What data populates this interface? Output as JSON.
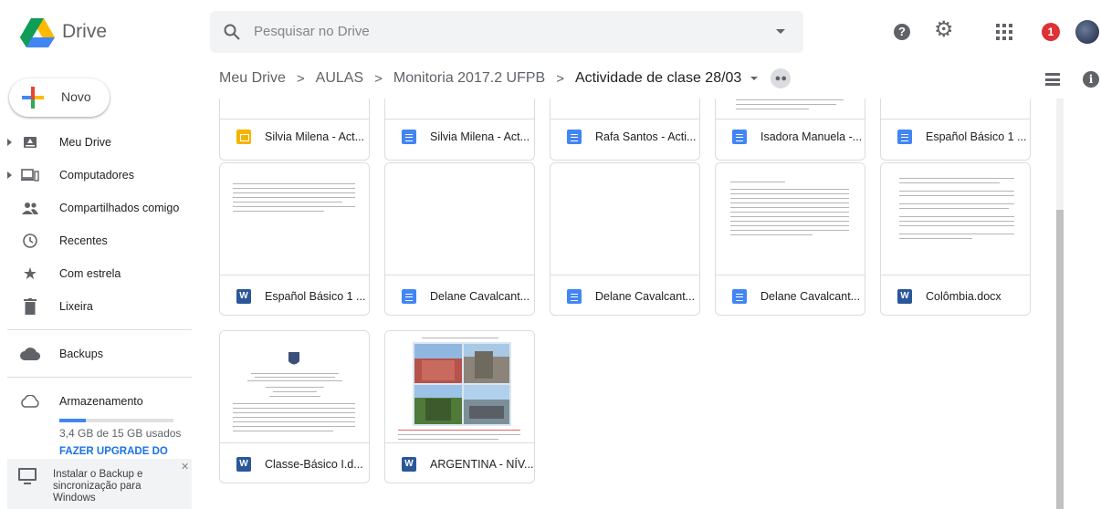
{
  "header": {
    "brand": "Drive",
    "search_placeholder": "Pesquisar no Drive",
    "notification_count": "1"
  },
  "breadcrumb": {
    "items": [
      "Meu Drive",
      "AULAS",
      "Monitoria 2017.2 UFPB"
    ],
    "current": "Actividade de clase 28/03"
  },
  "sidebar": {
    "new_label": "Novo",
    "items": [
      {
        "label": "Meu Drive",
        "icon": "drive-icon"
      },
      {
        "label": "Computadores",
        "icon": "computer-icon"
      },
      {
        "label": "Compartilhados comigo",
        "icon": "shared-icon"
      },
      {
        "label": "Recentes",
        "icon": "clock-icon"
      },
      {
        "label": "Com estrela",
        "icon": "star-icon"
      },
      {
        "label": "Lixeira",
        "icon": "trash-icon"
      },
      {
        "label": "Backups",
        "icon": "cloud-icon"
      },
      {
        "label": "Armazenamento",
        "icon": "cloud-outline-icon"
      }
    ],
    "storage_text": "3,4 GB de 15 GB usados",
    "storage_fraction": 0.23,
    "upgrade_label": "FAZER UPGRADE DO",
    "backup_prompt": "Instalar o Backup e sincronização para Windows"
  },
  "files": [
    {
      "name": "Silvia Milena - Act...",
      "type": "slide"
    },
    {
      "name": "Silvia Milena - Act...",
      "type": "doc"
    },
    {
      "name": "Rafa Santos - Acti...",
      "type": "doc"
    },
    {
      "name": "Isadora Manuela -...",
      "type": "doc"
    },
    {
      "name": "Español Básico 1 ...",
      "type": "doc"
    },
    {
      "name": "Español Básico 1 ...",
      "type": "word"
    },
    {
      "name": "Delane Cavalcant...",
      "type": "doc"
    },
    {
      "name": "Delane Cavalcant...",
      "type": "doc"
    },
    {
      "name": "Delane Cavalcant...",
      "type": "doc"
    },
    {
      "name": "Colômbia.docx",
      "type": "word"
    },
    {
      "name": "Classe-Básico I.d...",
      "type": "word"
    },
    {
      "name": "ARGENTINA - NÍV...",
      "type": "word"
    }
  ],
  "colors": {
    "doc": "#4285f4",
    "word": "#2b579a",
    "slide": "#f4b400",
    "upgrade": "#1a73e8",
    "notification": "#db3236"
  }
}
